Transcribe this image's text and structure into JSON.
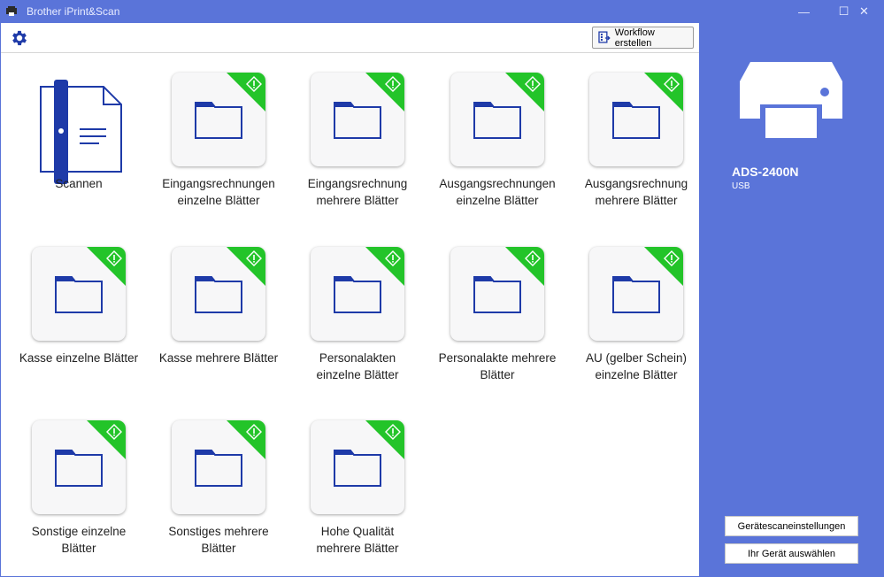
{
  "window": {
    "title": "Brother iPrint&Scan",
    "minimize_glyph": "—",
    "maximize_glyph": "☐",
    "close_glyph": "✕"
  },
  "toolbar": {
    "settings_icon": "gear-icon",
    "workflow_label": "Workflow erstellen"
  },
  "tiles": [
    {
      "label": "Scannen",
      "icon": "scan-icon"
    },
    {
      "label": "Eingangsrechnungen\neinzelne Blätter",
      "icon": "folder-icon"
    },
    {
      "label": "Eingangsrechnung\nmehrere Blätter",
      "icon": "folder-icon"
    },
    {
      "label": "Ausgangsrechnungen\neinzelne Blätter",
      "icon": "folder-icon"
    },
    {
      "label": "Ausgangsrechnung\nmehrere Blätter",
      "icon": "folder-icon"
    },
    {
      "label": "Kasse einzelne Blätter",
      "icon": "folder-icon"
    },
    {
      "label": "Kasse mehrere Blätter",
      "icon": "folder-icon"
    },
    {
      "label": "Personalakten\neinzelne Blätter",
      "icon": "folder-icon"
    },
    {
      "label": "Personalakte mehrere\nBlätter",
      "icon": "folder-icon"
    },
    {
      "label": "AU (gelber Schein)\neinzelne Blätter",
      "icon": "folder-icon"
    },
    {
      "label": "Sonstige einzelne\nBlätter",
      "icon": "folder-icon"
    },
    {
      "label": "Sonstiges mehrere\nBlätter",
      "icon": "folder-icon"
    },
    {
      "label": "Hohe Qualität\nmehrere Blätter",
      "icon": "folder-icon"
    }
  ],
  "device": {
    "name": "ADS-2400N",
    "connection": "USB"
  },
  "sidebar": {
    "settings_label": "Gerätescaneinstellungen",
    "select_device_label": "Ihr Gerät auswählen"
  },
  "colors": {
    "accent": "#5a74d9",
    "icon_blue": "#1e3aa8",
    "badge_green": "#23c429"
  }
}
